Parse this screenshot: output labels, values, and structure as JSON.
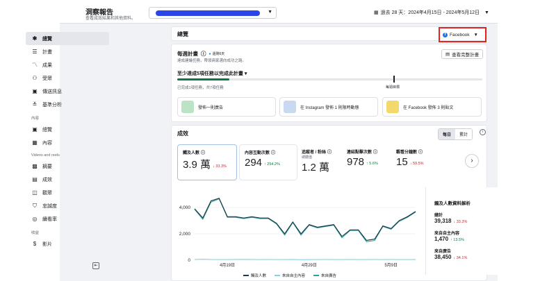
{
  "header": {
    "title": "洞察報告",
    "subtitle": "查看成效結果和其他資料。",
    "date_range": "過去 28 天：2024年4月15日 - 2024年5月12日"
  },
  "sidebar": {
    "items": [
      {
        "label": "總覽",
        "icon": "overview-icon"
      },
      {
        "label": "計畫",
        "icon": "plan-icon"
      },
      {
        "label": "成果",
        "icon": "results-icon"
      },
      {
        "label": "受眾",
        "icon": "audience-icon"
      },
      {
        "label": "傳送訊息",
        "icon": "messages-icon"
      },
      {
        "label": "基準分析",
        "icon": "benchmark-icon"
      }
    ],
    "content_section": "內容",
    "content_items": [
      {
        "label": "總覽",
        "icon": "content-overview-icon"
      },
      {
        "label": "內容",
        "icon": "content-icon"
      }
    ],
    "videos_section": "Videos and reels",
    "video_items": [
      {
        "label": "摘要",
        "icon": "summary-icon"
      },
      {
        "label": "成效",
        "icon": "performance-icon"
      },
      {
        "label": "觀眾",
        "icon": "viewers-icon"
      },
      {
        "label": "忠誠度",
        "icon": "loyalty-icon"
      },
      {
        "label": "續看率",
        "icon": "retention-icon"
      }
    ],
    "earnings_section": "收益",
    "earnings_items": [
      {
        "label": "影片",
        "icon": "earnings-icon"
      }
    ]
  },
  "overview": {
    "title": "總覽",
    "platform": "Facebook"
  },
  "weekly_plan": {
    "title": "每週計畫",
    "badge": "還剩6天",
    "subtitle": "達成建議任務，帶領商家邁向成功之路。",
    "view_button": "查看完整計畫",
    "goal_text": "至少達成5項任務以完成此計畫",
    "progress": 0.17,
    "goal_label": "每週目標",
    "done_text": "已完成1項任務，共7項任務",
    "tasks": [
      {
        "label": "發佈一則廣告"
      },
      {
        "label": "在 Instagram 發佈 1 則限時動態"
      },
      {
        "label": "在 Facebook 發佈 3 則貼文"
      }
    ]
  },
  "performance": {
    "title": "成效",
    "tab_daily": "每日",
    "tab_cumulative": "累計",
    "metrics": [
      {
        "label": "觸及人數",
        "value": "3.9 萬",
        "change": "↓ 33.3%",
        "dir": "down"
      },
      {
        "label": "內容互動次數",
        "value": "294",
        "change": "↑ 254.2%",
        "dir": "up"
      },
      {
        "label": "追蹤者 / 粉絲",
        "sub": "總體值",
        "value": "1.2 萬",
        "change": "",
        "dir": ""
      },
      {
        "label": "連結點擊次數",
        "value": "978",
        "change": "↑ 5.6%",
        "dir": "up"
      },
      {
        "label": "觀看分鐘數",
        "value": "15",
        "change": "↓ 59.5%",
        "dir": "down"
      }
    ]
  },
  "breakdown": {
    "title": "觸及人數資料解析",
    "total_label": "總計",
    "total_value": "39,318",
    "total_change": "↓ 33.3%",
    "organic_label": "來自自主內容",
    "organic_value": "1,470",
    "organic_change": "↑ 13.5%",
    "ads_label": "來自廣告",
    "ads_value": "38,450",
    "ads_change": "↓ 34.1%"
  },
  "chart_data": {
    "type": "line",
    "x": [
      "4/15",
      "4/16",
      "4/17",
      "4/18",
      "4/19",
      "4/20",
      "4/21",
      "4/22",
      "4/23",
      "4/24",
      "4/25",
      "4/26",
      "4/27",
      "4/28",
      "4/29",
      "4/30",
      "5/1",
      "5/2",
      "5/3",
      "5/4",
      "5/5",
      "5/6",
      "5/7",
      "5/8",
      "5/9",
      "5/10",
      "5/11",
      "5/12"
    ],
    "x_tick_labels": [
      "4月19日",
      "4月29日",
      "5月9日"
    ],
    "y_ticks": [
      "0",
      "2,000",
      "4,000"
    ],
    "ylim": [
      0,
      5000
    ],
    "series": [
      {
        "name": "觸及人數",
        "color": "#1c3a4a",
        "values": [
          3900,
          3200,
          4500,
          4700,
          3300,
          3300,
          3200,
          3300,
          3200,
          3200,
          2800,
          2000,
          2900,
          2000,
          2700,
          2500,
          2600,
          2700,
          1800,
          2300,
          2300,
          1500,
          1600,
          2600,
          2400,
          3000,
          3300,
          3700
        ]
      },
      {
        "name": "來自自主內容",
        "color": "#7fd3e8",
        "values": [
          60,
          80,
          60,
          50,
          50,
          60,
          70,
          60,
          50,
          60,
          50,
          50,
          60,
          40,
          50,
          50,
          60,
          50,
          50,
          60,
          50,
          50,
          60,
          50,
          60,
          50,
          50,
          60
        ]
      },
      {
        "name": "來自廣告",
        "color": "#2aa198",
        "values": [
          3850,
          3100,
          4400,
          4650,
          3250,
          3250,
          3150,
          3250,
          3150,
          3150,
          2750,
          1900,
          2850,
          1900,
          2650,
          2450,
          2550,
          2650,
          1700,
          2250,
          2250,
          1400,
          1500,
          2550,
          2350,
          2950,
          3250,
          3650
        ]
      }
    ]
  }
}
